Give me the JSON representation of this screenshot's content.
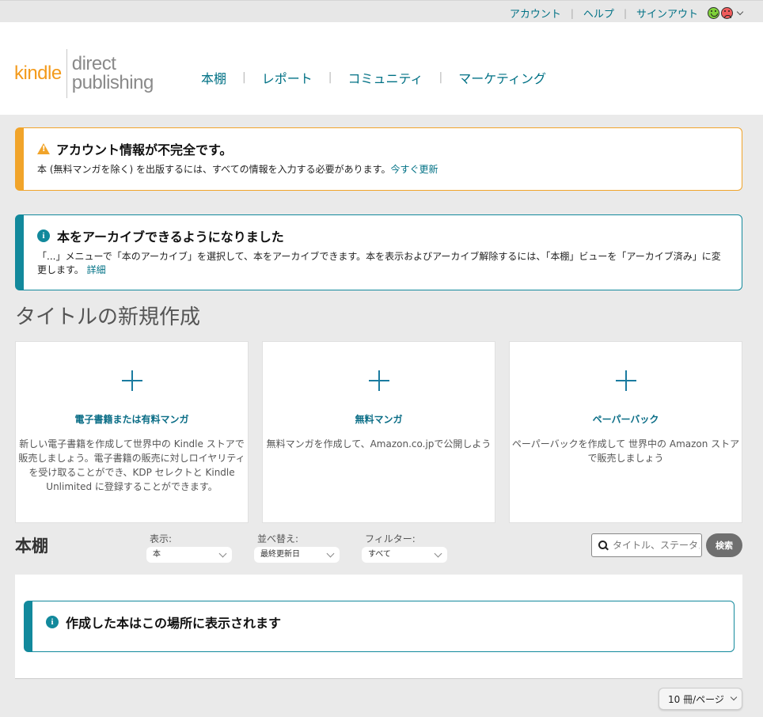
{
  "topbar": {
    "account": "アカウント",
    "help": "ヘルプ",
    "signout": "サインアウト"
  },
  "logo": {
    "kindle": "kindle",
    "direct": "direct",
    "publishing": "publishing"
  },
  "nav": {
    "items": [
      "本棚",
      "レポート",
      "コミュニティ",
      "マーケティング"
    ]
  },
  "warning": {
    "title": "アカウント情報が不完全です。",
    "body": "本 (無料マンガを除く) を出版するには、すべての情報を入力する必要があります。",
    "link": "今すぐ更新"
  },
  "info": {
    "title": "本をアーカイブできるようになりました",
    "body": "「...」メニューで「本のアーカイブ」を選択して、本をアーカイブできます。本を表示およびアーカイブ解除するには、「本棚」ビューを「アーカイブ済み」に変更します。",
    "link": "詳細"
  },
  "create": {
    "title": "タイトルの新規作成",
    "cards": [
      {
        "title": "電子書籍または有料マンガ",
        "desc": "新しい電子書籍を作成して世界中の Kindle ストアで販売しましょう。電子書籍の販売に対しロイヤリティを受け取ることができ、KDP セレクトと Kindle Unlimited に登録することができます。"
      },
      {
        "title": "無料マンガ",
        "desc": "無料マンガを作成して、Amazon.co.jpで公開しよう"
      },
      {
        "title": "ペーパーバック",
        "desc": "ペーパーバックを作成して 世界中の Amazon ストアで販売しましょう"
      }
    ]
  },
  "shelf": {
    "title": "本棚",
    "display_label": "表示:",
    "display_value": "本",
    "sort_label": "並べ替え:",
    "sort_value": "最終更新日",
    "filter_label": "フィルター:",
    "filter_value": "すべて",
    "search_placeholder": "タイトル、ステータス",
    "search_button": "検索",
    "empty_message": "作成した本はこの場所に表示されます",
    "per_page": "10 冊/ページ"
  }
}
